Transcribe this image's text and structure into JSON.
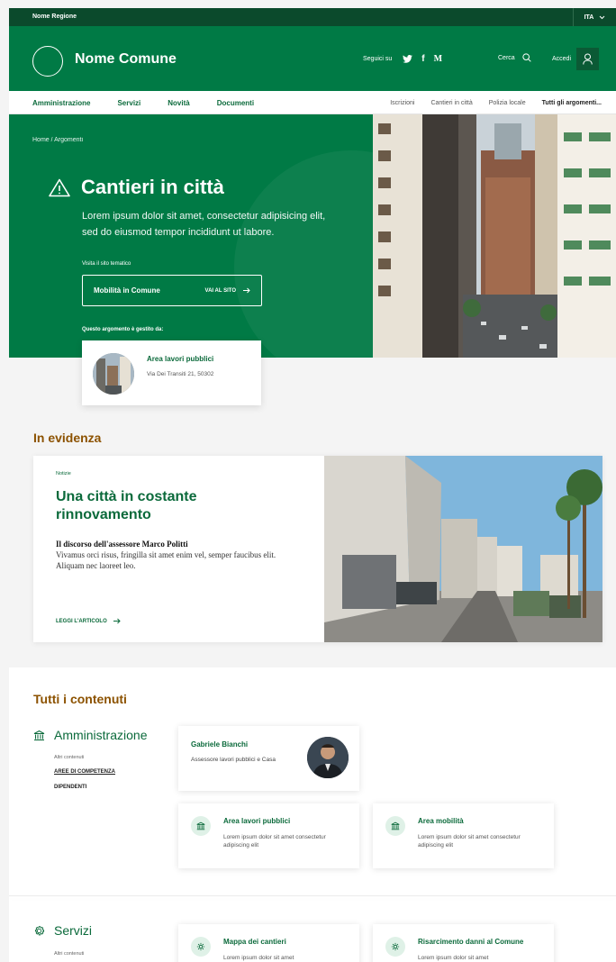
{
  "topbar": {
    "region": "Nome Regione",
    "lang": "ITA"
  },
  "header": {
    "brand": "Nome Comune",
    "follow_label": "Seguici su",
    "social": [
      "twitter-icon",
      "facebook-icon",
      "medium-icon"
    ],
    "search_label": "Cerca",
    "login_label": "Accedi"
  },
  "nav": {
    "main": [
      "Amministrazione",
      "Servizi",
      "Novità",
      "Documenti"
    ],
    "secondary": [
      "Iscrizioni",
      "Cantieri in città",
      "Polizia locale",
      "Tutti gli argomenti..."
    ]
  },
  "hero": {
    "breadcrumb": "Home / Argomenti",
    "title": "Cantieri in città",
    "description": "Lorem ipsum dolor sit amet, consectetur adipisicing elit, sed do eiusmod tempor incididunt ut labore.",
    "visit_label": "Visita il sito tematico",
    "site_button": "Mobilità in Comune",
    "site_go": "VAI AL SITO",
    "managed_label": "Questo argomento è gestito da:",
    "office": {
      "title": "Area lavori pubblici",
      "address": "Via Dei Transiti 21, 50302"
    }
  },
  "evidence": {
    "section_title": "In evidenza",
    "kind": "Notizie",
    "title": "Una città in costante rinnovamento",
    "lead": "Il discorso dell'assessore Marco Politti",
    "text": "Vivamus orci risus, fringilla sit amet enim vel, semper faucibus elit. Aliquam nec laoreet leo.",
    "read_more": "LEGGI L'ARTICOLO"
  },
  "contents": {
    "section_title": "Tutti i contenuti",
    "admin": {
      "title": "Amministrazione",
      "more_label": "Altri contenuti",
      "links": [
        "AREE DI COMPETENZA",
        "DIPENDENTI"
      ],
      "person": {
        "name": "Gabriele Bianchi",
        "role": "Assessore lavori pubblici e Casa"
      },
      "cards": [
        {
          "title": "Area lavori pubblici",
          "desc": "Lorem ipsum dolor sit amet consectetur adipiscing elit"
        },
        {
          "title": "Area mobilità",
          "desc": "Lorem ipsum dolor sit amet consectetur adipiscing elit"
        }
      ]
    },
    "services": {
      "title": "Servizi",
      "more_label": "Altri contenuti",
      "cards": [
        {
          "title": "Mappa dei cantieri",
          "desc": "Lorem ipsum dolor sit amet"
        },
        {
          "title": "Risarcimento danni al Comune",
          "desc": "Lorem ipsum dolor sit amet"
        }
      ]
    }
  },
  "colors": {
    "primary": "#007a45",
    "dark": "#0b4a2c",
    "accent": "#8c5200"
  }
}
